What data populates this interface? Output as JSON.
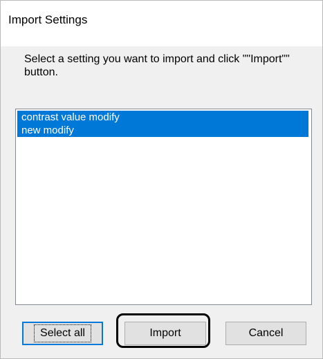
{
  "dialog": {
    "title": "Import Settings",
    "instruction": "Select a setting you want to import and click \"\"Import\"\" button.",
    "list_items": [
      "contrast value modify",
      "new modify"
    ],
    "buttons": {
      "select_all": "Select all",
      "import": "Import",
      "cancel": "Cancel"
    },
    "colors": {
      "selection": "#0078d7",
      "dialog_bg": "#f0f0f0",
      "highlight_outline": "#000000"
    }
  }
}
